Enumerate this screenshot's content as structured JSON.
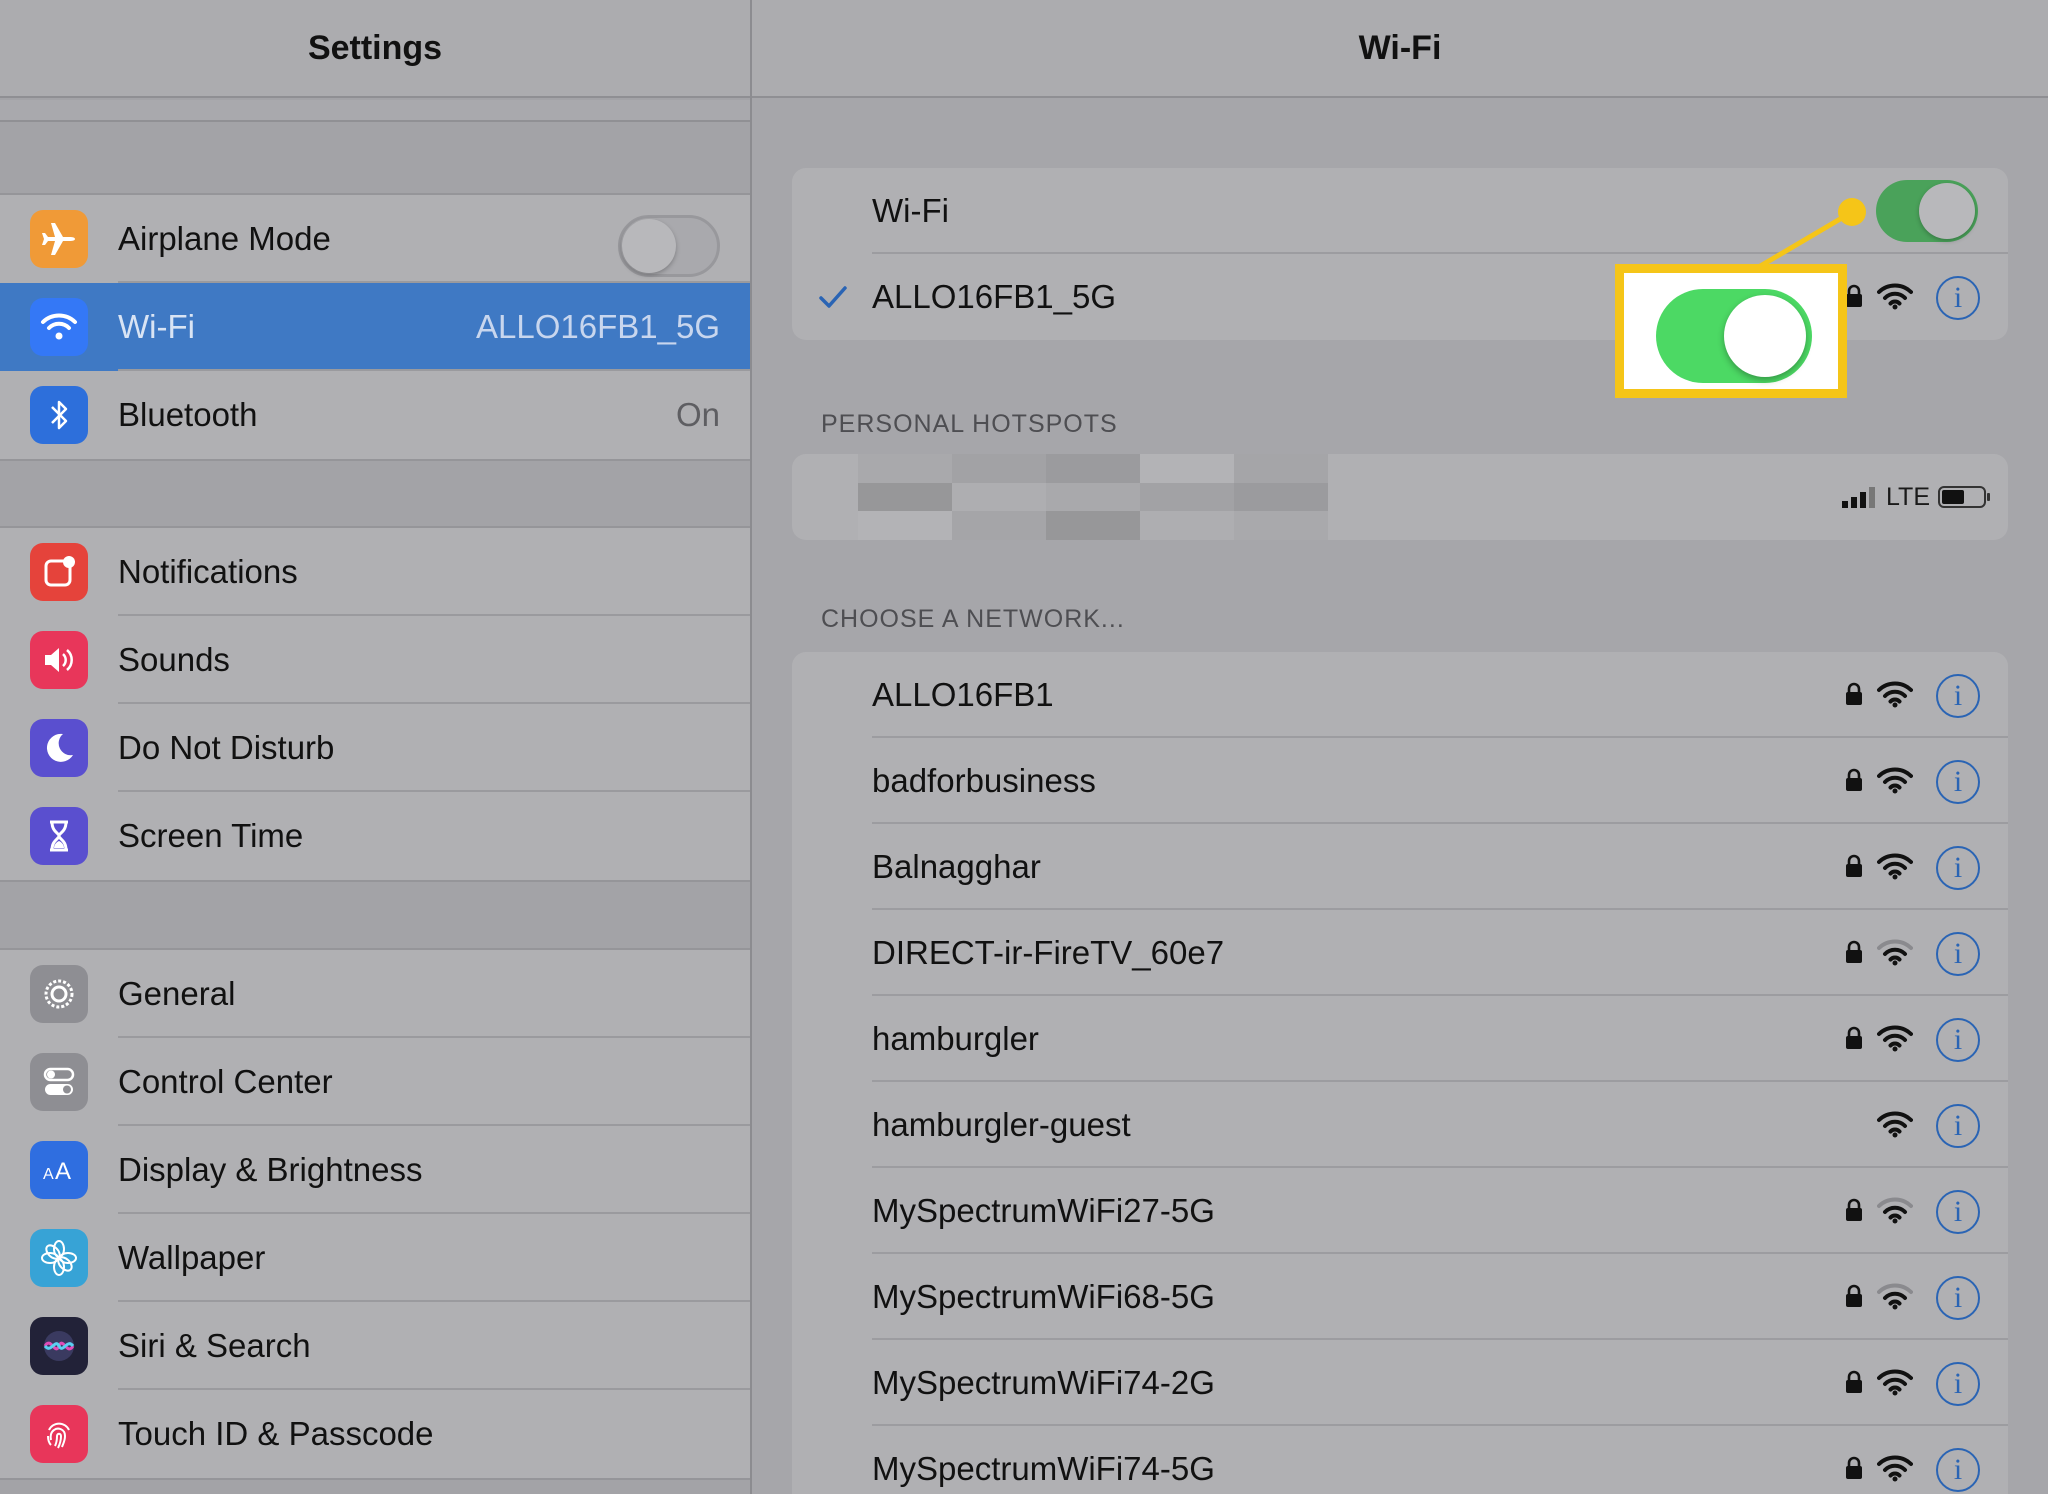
{
  "left_pane": {
    "title": "Settings",
    "groups": [
      [
        {
          "key": "airplane",
          "label": "Airplane Mode",
          "value": "",
          "control": "toggle-off",
          "icon": "airplane-icon",
          "color": "#f09a37"
        },
        {
          "key": "wifi",
          "label": "Wi-Fi",
          "value": "ALLO16FB1_5G",
          "icon": "wifi-icon",
          "color": "#3478f6",
          "selected": true
        },
        {
          "key": "bluetooth",
          "label": "Bluetooth",
          "value": "On",
          "icon": "bluetooth-icon",
          "color": "#2d6fdb"
        }
      ],
      [
        {
          "key": "notifications",
          "label": "Notifications",
          "value": "",
          "icon": "notifications-icon",
          "color": "#e5433b"
        },
        {
          "key": "sounds",
          "label": "Sounds",
          "value": "",
          "icon": "speaker-icon",
          "color": "#e8365a"
        },
        {
          "key": "dnd",
          "label": "Do Not Disturb",
          "value": "",
          "icon": "moon-icon",
          "color": "#5a4fcf"
        },
        {
          "key": "screentime",
          "label": "Screen Time",
          "value": "",
          "icon": "hourglass-icon",
          "color": "#5a4fcf"
        }
      ],
      [
        {
          "key": "general",
          "label": "General",
          "value": "",
          "icon": "gear-icon",
          "color": "#8e8e93"
        },
        {
          "key": "control",
          "label": "Control Center",
          "value": "",
          "icon": "switches-icon",
          "color": "#8e8e93"
        },
        {
          "key": "display",
          "label": "Display & Brightness",
          "value": "",
          "icon": "text-size-icon",
          "color": "#2f6ee0"
        },
        {
          "key": "wallpaper",
          "label": "Wallpaper",
          "value": "",
          "icon": "flower-icon",
          "color": "#37a3d6"
        },
        {
          "key": "siri",
          "label": "Siri & Search",
          "value": "",
          "icon": "siri-icon",
          "color": "#222238"
        },
        {
          "key": "touchid",
          "label": "Touch ID & Passcode",
          "value": "",
          "icon": "fingerprint-icon",
          "color": "#e8365a"
        }
      ]
    ]
  },
  "right_pane": {
    "title": "Wi-Fi",
    "wifi_toggle_label": "Wi-Fi",
    "wifi_enabled": true,
    "connected_network": "ALLO16FB1_5G",
    "hotspots_header": "PERSONAL HOTSPOTS",
    "hotspot": {
      "network_type": "LTE",
      "signal_bars": 4,
      "battery_level": 0.5
    },
    "choose_header": "CHOOSE A NETWORK...",
    "networks": [
      {
        "name": "ALLO16FB1",
        "secured": true,
        "signal": 3
      },
      {
        "name": "badforbusiness",
        "secured": true,
        "signal": 3
      },
      {
        "name": "Balnagghar",
        "secured": true,
        "signal": 3
      },
      {
        "name": "DIRECT-ir-FireTV_60e7",
        "secured": true,
        "signal": 2
      },
      {
        "name": "hamburgler",
        "secured": true,
        "signal": 3
      },
      {
        "name": "hamburgler-guest",
        "secured": false,
        "signal": 3
      },
      {
        "name": "MySpectrumWiFi27-5G",
        "secured": true,
        "signal": 2
      },
      {
        "name": "MySpectrumWiFi68-5G",
        "secured": true,
        "signal": 2
      },
      {
        "name": "MySpectrumWiFi74-2G",
        "secured": true,
        "signal": 3
      },
      {
        "name": "MySpectrumWiFi74-5G",
        "secured": true,
        "signal": 3
      }
    ]
  },
  "callout": {
    "highlight_color": "#f5c518",
    "toggle_color": "#4cd964"
  }
}
